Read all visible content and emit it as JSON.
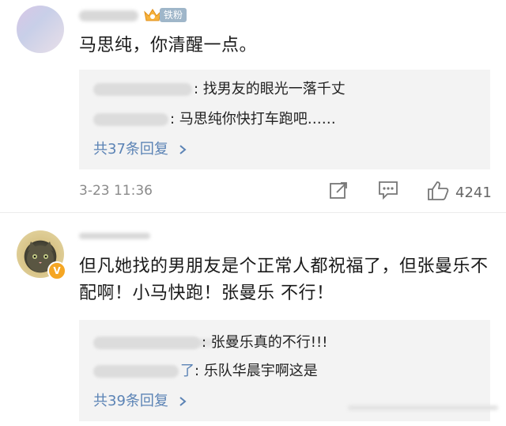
{
  "comments": [
    {
      "badge": "铁粉",
      "text": "马思纯，你清醒一点。",
      "replies": [
        {
          "text": "找男友的眼光一落千丈"
        },
        {
          "text": "马思纯你快打车跑吧……"
        }
      ],
      "more": "共37条回复",
      "date": "3-23 11:36",
      "likes": "4241"
    },
    {
      "text": "但凡她找的男朋友是个正常人都祝福了，但张曼乐不配啊！小马快跑！张曼乐 不行！",
      "replies": [
        {
          "text": "张曼乐真的不行!!!"
        },
        {
          "name_tail": "了",
          "text": "乐队华晨宇啊这是"
        }
      ],
      "more": "共39条回复"
    }
  ]
}
